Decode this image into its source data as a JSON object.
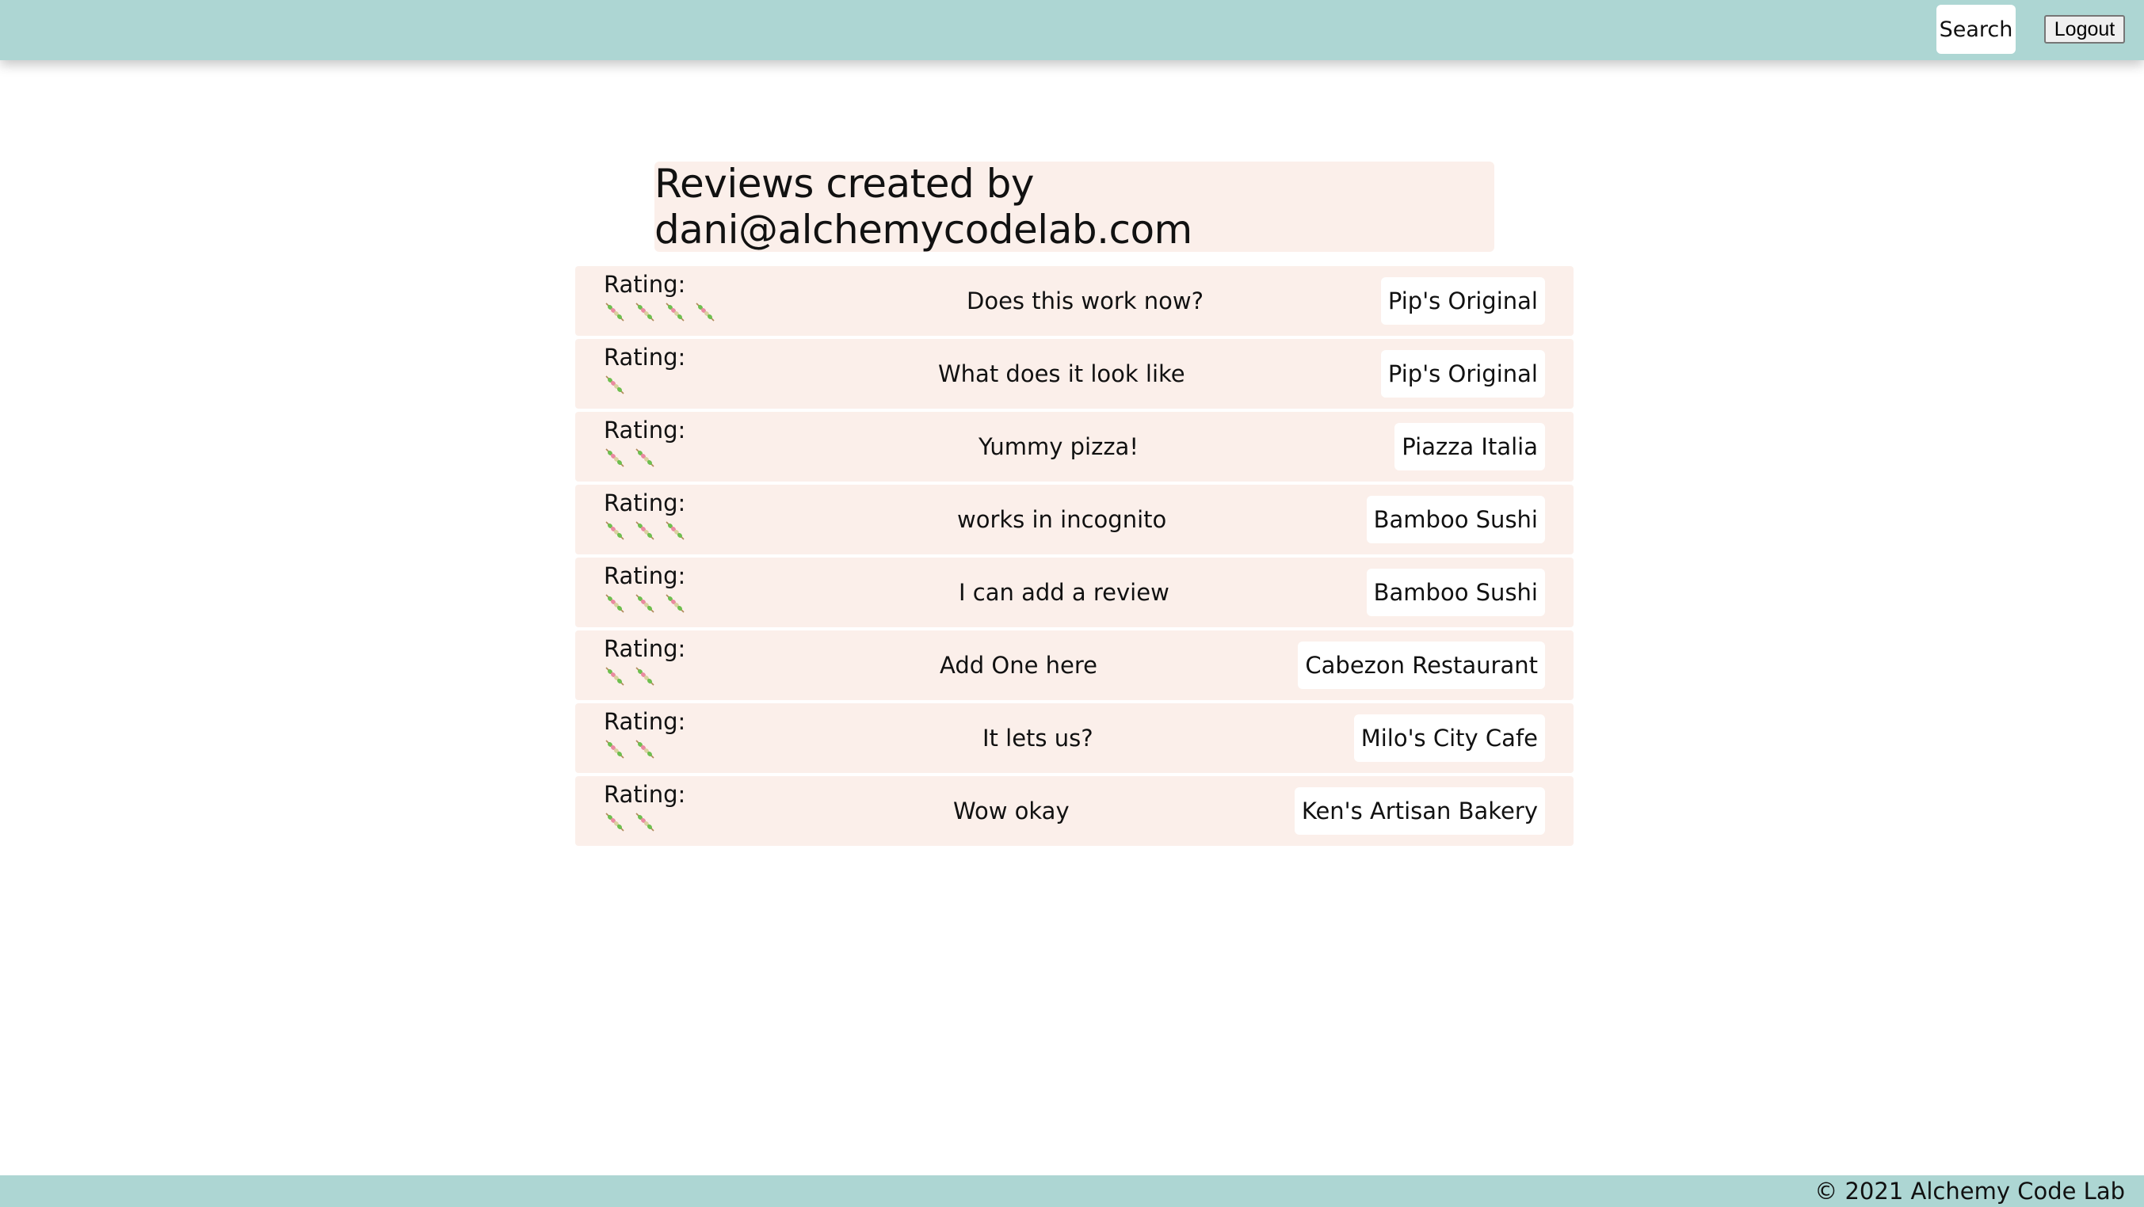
{
  "header": {
    "search_label": "Search",
    "logout_label": "Logout"
  },
  "page": {
    "title": "Reviews created by dani@alchemycodelab.com"
  },
  "rating_label": "Rating:",
  "rating_icon": "kebab-skewer-icon",
  "reviews": [
    {
      "rating": 4,
      "rating_label": "Rating:",
      "text": "Does this work now?",
      "restaurant": "Pip's Original"
    },
    {
      "rating": 1,
      "rating_label": "Rating:",
      "text": "What does it look like",
      "restaurant": "Pip's Original"
    },
    {
      "rating": 2,
      "rating_label": "Rating:",
      "text": "Yummy pizza!",
      "restaurant": "Piazza Italia"
    },
    {
      "rating": 3,
      "rating_label": "Rating:",
      "text": "works in incognito",
      "restaurant": "Bamboo Sushi"
    },
    {
      "rating": 3,
      "rating_label": "Rating:",
      "text": "I can add a review",
      "restaurant": "Bamboo Sushi"
    },
    {
      "rating": 2,
      "rating_label": "Rating:",
      "text": "Add One here",
      "restaurant": "Cabezon Restaurant"
    },
    {
      "rating": 2,
      "rating_label": "Rating:",
      "text": "It lets us?",
      "restaurant": "Milo's City Cafe"
    },
    {
      "rating": 2,
      "rating_label": "Rating:",
      "text": "Wow okay",
      "restaurant": "Ken's Artisan Bakery"
    }
  ],
  "footer": {
    "copyright": "© 2021 Alchemy Code Lab"
  },
  "colors": {
    "header_bg": "#add6d3",
    "card_bg": "#fbefea",
    "badge_bg": "#ffffff"
  }
}
